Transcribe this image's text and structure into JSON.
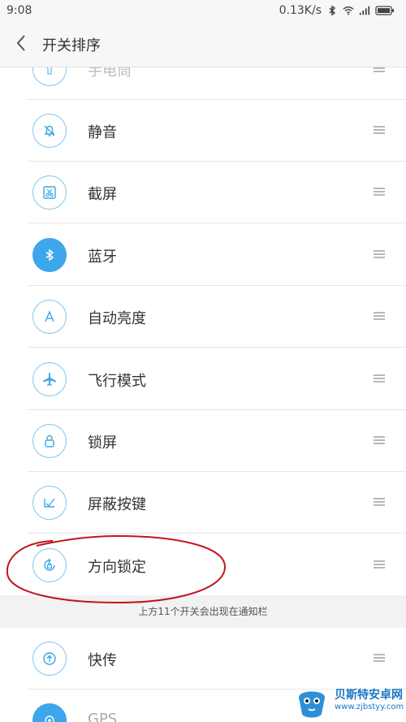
{
  "status_bar": {
    "time": "9:08",
    "speed": "0.13K/s"
  },
  "header": {
    "back_icon": "chevron-left-icon",
    "title": "开关排序"
  },
  "items": [
    {
      "label": "手电筒",
      "icon": "flashlight-icon"
    },
    {
      "label": "静音",
      "icon": "mute-bell-icon"
    },
    {
      "label": "截屏",
      "icon": "screenshot-scissors-icon"
    },
    {
      "label": "蓝牙",
      "icon": "bluetooth-icon"
    },
    {
      "label": "自动亮度",
      "icon": "auto-brightness-icon"
    },
    {
      "label": "飞行模式",
      "icon": "airplane-icon"
    },
    {
      "label": "锁屏",
      "icon": "lock-icon"
    },
    {
      "label": "屏蔽按键",
      "icon": "block-keys-icon"
    },
    {
      "label": "方向锁定",
      "icon": "rotation-lock-icon"
    },
    {
      "label": "快传",
      "icon": "quick-transfer-icon"
    },
    {
      "label": "GPS",
      "icon": "gps-icon"
    }
  ],
  "section_note": "上方11个开关会出现在通知栏",
  "watermark": {
    "title": "贝斯特安卓网",
    "url": "www.zjbstyy.com"
  },
  "colors": {
    "accent": "#3ea6ea",
    "annotation": "#c0161d"
  }
}
